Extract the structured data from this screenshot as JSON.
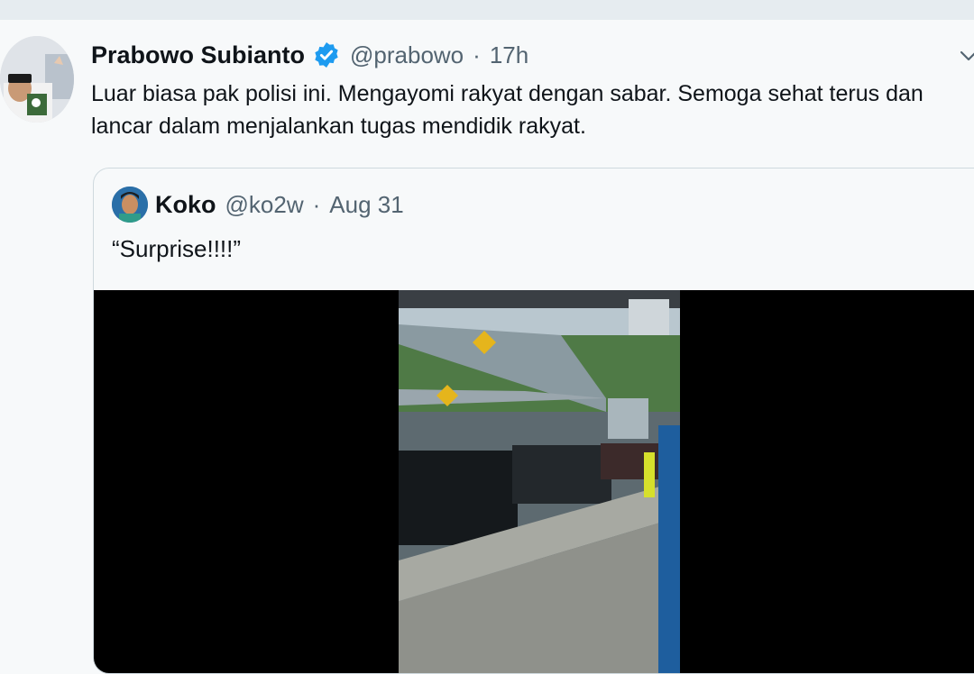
{
  "tweet": {
    "author_name": "Prabowo Subianto",
    "handle": "@prabowo",
    "separator": "·",
    "time": "17h",
    "text": "Luar biasa pak polisi ini. Mengayomi rakyat dengan sabar. Semoga sehat terus dan lancar dalam menjalankan tugas mendidik rakyat.",
    "verified_color": "#1d9bf0"
  },
  "quoted_tweet": {
    "author_name": "Koko",
    "handle": "@ko2w",
    "separator": "·",
    "time": "Aug 31",
    "text": "“Surprise!!!!”"
  },
  "icons": {
    "verified": "verified-badge-icon",
    "more": "chevron-down-icon"
  }
}
